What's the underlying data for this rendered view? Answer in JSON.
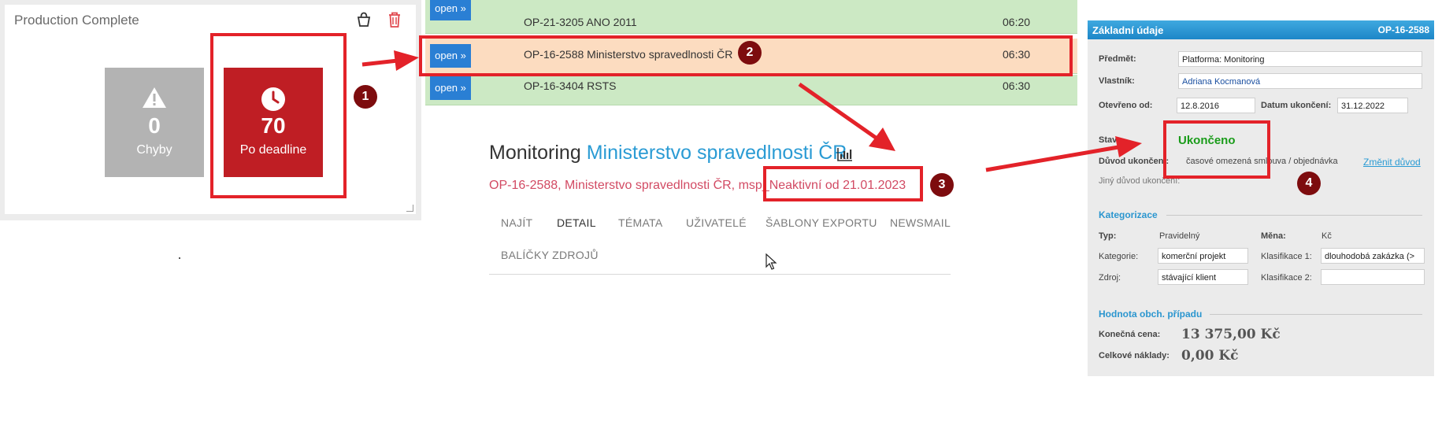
{
  "production": {
    "title": "Production Complete",
    "tiles": [
      {
        "value": "0",
        "label": "Chyby"
      },
      {
        "value": "70",
        "label": "Po deadline"
      }
    ]
  },
  "badges": [
    "1",
    "2",
    "3",
    "4"
  ],
  "list": {
    "rows": [
      {
        "button": "open »",
        "name": "OP-21-3205 ANO 2011",
        "time": "06:20"
      },
      {
        "button": "open »",
        "name": "OP-16-2588 Ministerstvo spravedlnosti ČR",
        "time": "06:30"
      },
      {
        "button": "open »",
        "name": "OP-16-3404 RSTS",
        "time": "06:30"
      }
    ]
  },
  "monitoring": {
    "title_prefix": "Monitoring",
    "title_link": "Ministerstvo spravedlnosti ČR",
    "subtitle_prefix": "OP-16-2588, Ministerstvo spravedlnosti ČR, msp_",
    "subtitle_status": "Neaktivní od 21.01.2023",
    "tabs": [
      "NAJÍT",
      "DETAIL",
      "TÉMATA",
      "UŽIVATELÉ",
      "ŠABLONY EXPORTU",
      "NEWSMAIL",
      "BALÍČKY ZDROJŮ"
    ],
    "active_tab": "DETAIL"
  },
  "info": {
    "header": "Základní údaje",
    "code": "OP-16-2588",
    "predmet_label": "Předmět:",
    "predmet": "Platforma: Monitoring",
    "vlastnik_label": "Vlastník:",
    "vlastnik": "Adriana Kocmanová",
    "otevreno_label": "Otevřeno od:",
    "otevreno": "12.8.2016",
    "datum_label": "Datum ukončení:",
    "datum": "31.12.2022",
    "stav_label": "Stav:",
    "stav": "Ukončeno",
    "duvod_label": "Důvod ukončení:",
    "duvod": "časové omezená smlouva / objednávka",
    "zmenit": "Změnit důvod",
    "jiny_label": "Jiný důvod ukončení:",
    "kategorizace": "Kategorizace",
    "typ_label": "Typ:",
    "typ": "Pravidelný",
    "mena_label": "Měna:",
    "mena": "Kč",
    "kategorie_label": "Kategorie:",
    "kategorie": "komerční projekt",
    "klas1_label": "Klasifikace 1:",
    "klas1": "dlouhodobá zakázka (>",
    "zdroj_label": "Zdroj:",
    "zdroj": "stávající klient",
    "klas2_label": "Klasifikace 2:",
    "klas2": "",
    "hodnota": "Hodnota obch. případu",
    "konecna_label": "Konečná cena:",
    "konecna": "13 375,00 Kč",
    "naklady_label": "Celkové náklady:",
    "naklady": "0,00 Kč"
  },
  "colors": {
    "highlight": "#e32229",
    "badge": "#7d0c0e",
    "tile_red": "#bf1e24",
    "list_green": "#cce9c4",
    "list_selected": "#fcdcc0",
    "link": "#2a9bd4",
    "status_green": "#1a9c1a"
  },
  "icons": [
    "basket-icon",
    "trash-icon",
    "warning-icon",
    "clock-icon",
    "bar-chart-icon",
    "mouse-cursor-icon"
  ]
}
